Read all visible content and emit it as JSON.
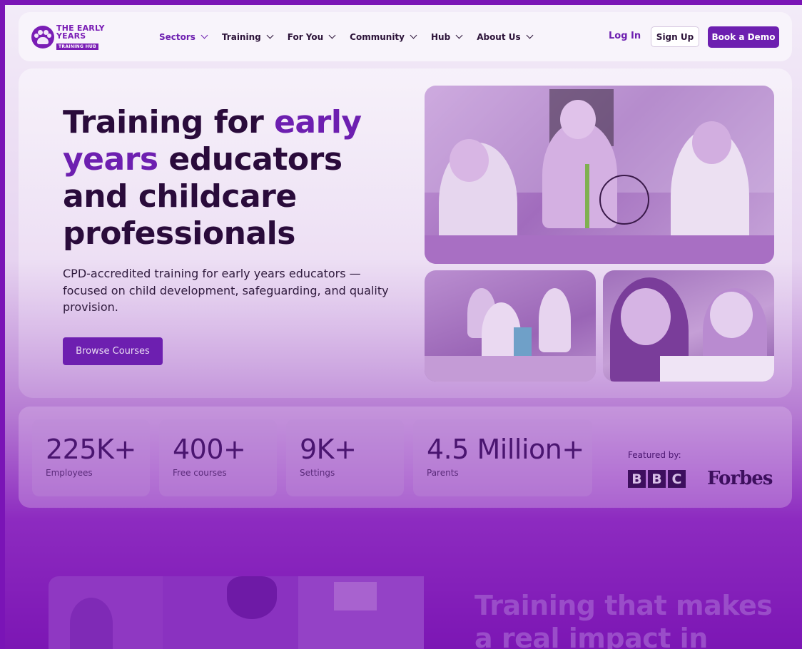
{
  "brand": {
    "line1": "THE EARLY",
    "line2": "YEARS",
    "line3": "TRAINING HUB",
    "accent_color": "#6d1fb0"
  },
  "nav": {
    "items": [
      {
        "label": "Sectors",
        "icon": "chevron-down-icon"
      },
      {
        "label": "Training",
        "icon": "chevron-down-icon"
      },
      {
        "label": "For You",
        "icon": "chevron-down-icon"
      },
      {
        "label": "Community",
        "icon": "chevron-down-icon"
      },
      {
        "label": "Hub",
        "icon": "chevron-down-icon"
      },
      {
        "label": "About Us",
        "icon": "chevron-down-icon"
      }
    ],
    "login_label": "Log In",
    "signup_label": "Sign Up",
    "demo_label": "Book a Demo"
  },
  "hero": {
    "title_part1": "Training for ",
    "title_accent": "early years",
    "title_part2": " educators and childcare professionals",
    "subtitle": "CPD-accredited training for early years educators — focused on child development, safeguarding, and quality provision.",
    "cta_label": "Browse Courses"
  },
  "stats": [
    {
      "value": "225K+",
      "label": "Employees"
    },
    {
      "value": "400+",
      "label": "Free courses"
    },
    {
      "value": "9K+",
      "label": "Settings"
    },
    {
      "value": "4.5 Million+",
      "label": "Parents"
    }
  ],
  "featured": {
    "label": "Featured by:",
    "bbc_letters": [
      "B",
      "B",
      "C"
    ],
    "forbes": "Forbes"
  },
  "impact": {
    "title": "Training that makes a real impact in"
  }
}
